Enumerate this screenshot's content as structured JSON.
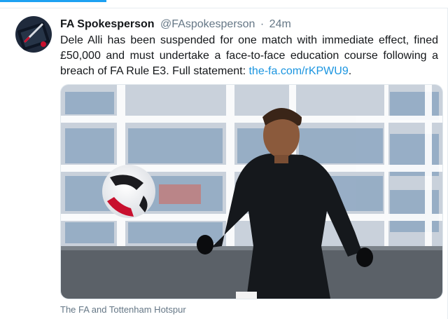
{
  "tweet": {
    "author_name": "FA Spokesperson",
    "author_handle": "@FAspokesperson",
    "separator": "·",
    "timestamp": "24m",
    "text": "Dele Alli has been suspended for one match with immediate effect, fined £50,000 and must undertake a face-to-face education course following a breach of FA Rule E3. Full statement: ",
    "link_text": "the-fa.com/rKPWU9",
    "text_end": ".",
    "media_caption": "The FA and Tottenham Hotspur"
  },
  "colors": {
    "accent": "#1da1f2",
    "link": "#1b95e0",
    "muted": "#657786",
    "text": "#14171a"
  },
  "icons": {
    "avatar": "fa-notebook-pen-avatar"
  }
}
